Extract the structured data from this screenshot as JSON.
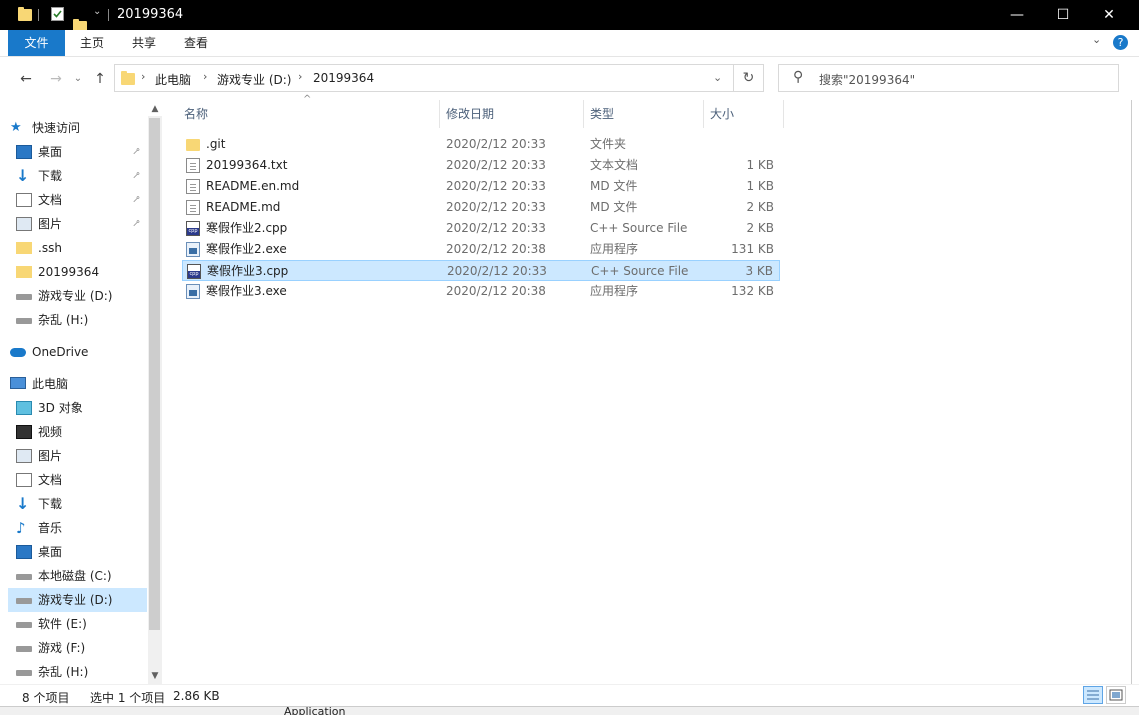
{
  "window": {
    "title": "20199364",
    "minimize_glyph": "—",
    "maximize_glyph": "☐",
    "close_glyph": "✕"
  },
  "ribbon": {
    "tabs": [
      "文件",
      "主页",
      "共享",
      "查看"
    ],
    "expand_glyph": "⌄",
    "help_glyph": "?"
  },
  "nav": {
    "back_glyph": "←",
    "forward_glyph": "→",
    "history_glyph": "⌄",
    "up_glyph": "↑"
  },
  "address": {
    "breadcrumbs": [
      "此电脑",
      "游戏专业 (D:)",
      "20199364"
    ],
    "separator": "›",
    "dropdown_glyph": "⌄",
    "refresh_glyph": "↻"
  },
  "search": {
    "placeholder": "搜索\"20199364\"",
    "icon_glyph": "⚲"
  },
  "sidebar": {
    "pin_glyph": "📌",
    "items": [
      {
        "label": "快速访问",
        "icon": "star-icon",
        "pinned": false
      },
      {
        "label": "桌面",
        "icon": "desktop-icon",
        "pinned": true
      },
      {
        "label": "下载",
        "icon": "download-icon",
        "pinned": true
      },
      {
        "label": "文档",
        "icon": "document-icon",
        "pinned": true
      },
      {
        "label": "图片",
        "icon": "picture-icon",
        "pinned": true
      },
      {
        "label": ".ssh",
        "icon": "folder-icon",
        "pinned": false
      },
      {
        "label": "20199364",
        "icon": "folder-icon",
        "pinned": false
      },
      {
        "label": "游戏专业 (D:)",
        "icon": "drive-icon",
        "pinned": false
      },
      {
        "label": "杂乱 (H:)",
        "icon": "drive-icon",
        "pinned": false
      },
      {
        "label": "OneDrive",
        "icon": "cloud-icon",
        "pinned": false
      },
      {
        "label": "此电脑",
        "icon": "computer-icon",
        "pinned": false
      },
      {
        "label": "3D 对象",
        "icon": "cube-icon",
        "pinned": false
      },
      {
        "label": "视频",
        "icon": "video-icon",
        "pinned": false
      },
      {
        "label": "图片",
        "icon": "picture-icon",
        "pinned": false
      },
      {
        "label": "文档",
        "icon": "document-icon",
        "pinned": false
      },
      {
        "label": "下载",
        "icon": "download-icon",
        "pinned": false
      },
      {
        "label": "音乐",
        "icon": "music-icon",
        "pinned": false
      },
      {
        "label": "桌面",
        "icon": "desktop-icon",
        "pinned": false
      },
      {
        "label": "本地磁盘 (C:)",
        "icon": "system-drive-icon",
        "pinned": false
      },
      {
        "label": "游戏专业 (D:)",
        "icon": "drive-icon",
        "pinned": false,
        "selected": true
      },
      {
        "label": "软件 (E:)",
        "icon": "drive-icon",
        "pinned": false
      },
      {
        "label": "游戏 (F:)",
        "icon": "drive-icon",
        "pinned": false
      },
      {
        "label": "杂乱 (H:)",
        "icon": "drive-icon",
        "pinned": false
      }
    ],
    "scroll_up_glyph": "▲",
    "scroll_down_glyph": "▼"
  },
  "columns": {
    "name": "名称",
    "date": "修改日期",
    "type": "类型",
    "size": "大小",
    "sort_glyph": "^"
  },
  "files": [
    {
      "name": ".git",
      "date": "2020/2/12 20:33",
      "type": "文件夹",
      "size": "",
      "icon": "folder-icon"
    },
    {
      "name": "20199364.txt",
      "date": "2020/2/12 20:33",
      "type": "文本文档",
      "size": "1 KB",
      "icon": "text-file-icon"
    },
    {
      "name": "README.en.md",
      "date": "2020/2/12 20:33",
      "type": "MD 文件",
      "size": "1 KB",
      "icon": "file-icon"
    },
    {
      "name": "README.md",
      "date": "2020/2/12 20:33",
      "type": "MD 文件",
      "size": "2 KB",
      "icon": "file-icon"
    },
    {
      "name": "寒假作业2.cpp",
      "date": "2020/2/12 20:33",
      "type": "C++ Source File",
      "size": "2 KB",
      "icon": "cpp-file-icon"
    },
    {
      "name": "寒假作业2.exe",
      "date": "2020/2/12 20:38",
      "type": "应用程序",
      "size": "131 KB",
      "icon": "exe-file-icon"
    },
    {
      "name": "寒假作业3.cpp",
      "date": "2020/2/12 20:33",
      "type": "C++ Source File",
      "size": "3 KB",
      "icon": "cpp-file-icon",
      "selected": true
    },
    {
      "name": "寒假作业3.exe",
      "date": "2020/2/12 20:38",
      "type": "应用程序",
      "size": "132 KB",
      "icon": "exe-file-icon"
    }
  ],
  "status": {
    "item_count": "8 个项目",
    "selection": "选中 1 个项目",
    "selection_size": "2.86 KB"
  },
  "background_window": {
    "label": "Application"
  },
  "colors": {
    "accent": "#1979ca",
    "selection": "#cce8ff",
    "folder": "#f8d775"
  }
}
